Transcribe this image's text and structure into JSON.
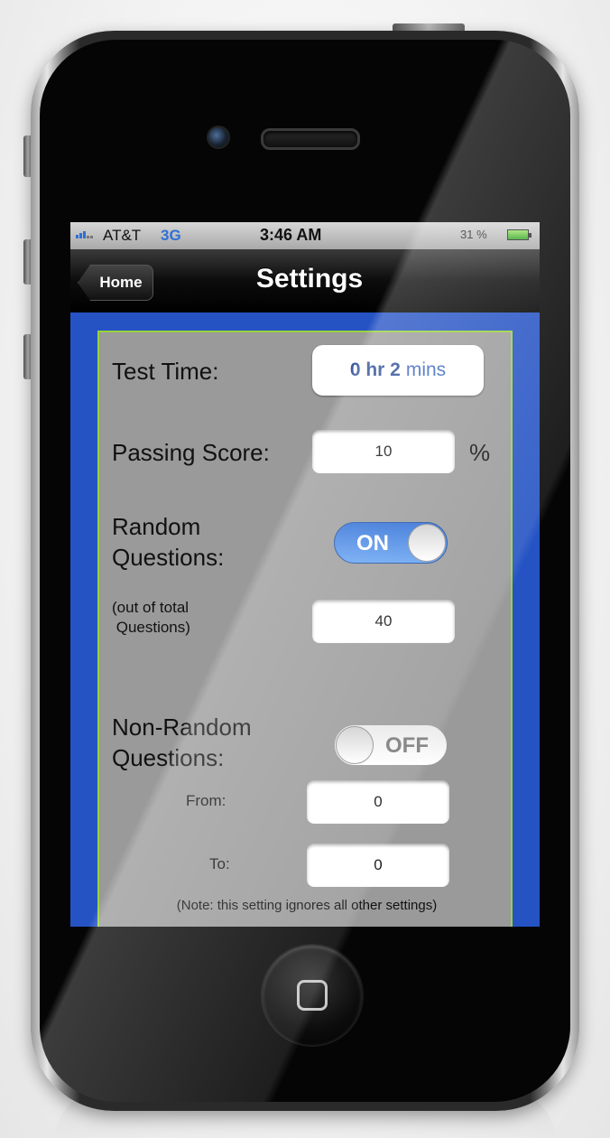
{
  "status_bar": {
    "carrier": "AT&T",
    "network": "3G",
    "time": "3:46 AM",
    "battery": "31 %",
    "battery_icon": "battery-charging-icon",
    "signal_icon": "signal-bars-icon"
  },
  "nav": {
    "back_label": "Home",
    "title": "Settings"
  },
  "settings": {
    "test_time": {
      "label": "Test Time:",
      "value_hours": "0 hr 2",
      "value_unit": "mins"
    },
    "passing_score": {
      "label": "Passing Score:",
      "value": "10",
      "unit": "%"
    },
    "random_questions": {
      "label_line1": "Random",
      "label_line2": "Questions:",
      "toggle_state": "ON"
    },
    "random_count": {
      "label_line1": "(out of total",
      "label_line2": " Questions)",
      "value": "40"
    },
    "non_random_questions": {
      "label_line1": "Non-Random",
      "label_line2": "Questions:",
      "toggle_state": "OFF"
    },
    "from": {
      "label": "From:",
      "value": "0"
    },
    "to": {
      "label": "To:",
      "value": "0"
    },
    "note": "(Note: this setting ignores all other settings)"
  },
  "colors": {
    "screen_background": "#2553c4",
    "panel_background": "#9a9a9a",
    "panel_border": "#9bd23b",
    "toggle_on": "#2c6cd6",
    "time_text": "#2d4f96"
  },
  "device": {
    "home_button_icon": "home-square-icon"
  }
}
